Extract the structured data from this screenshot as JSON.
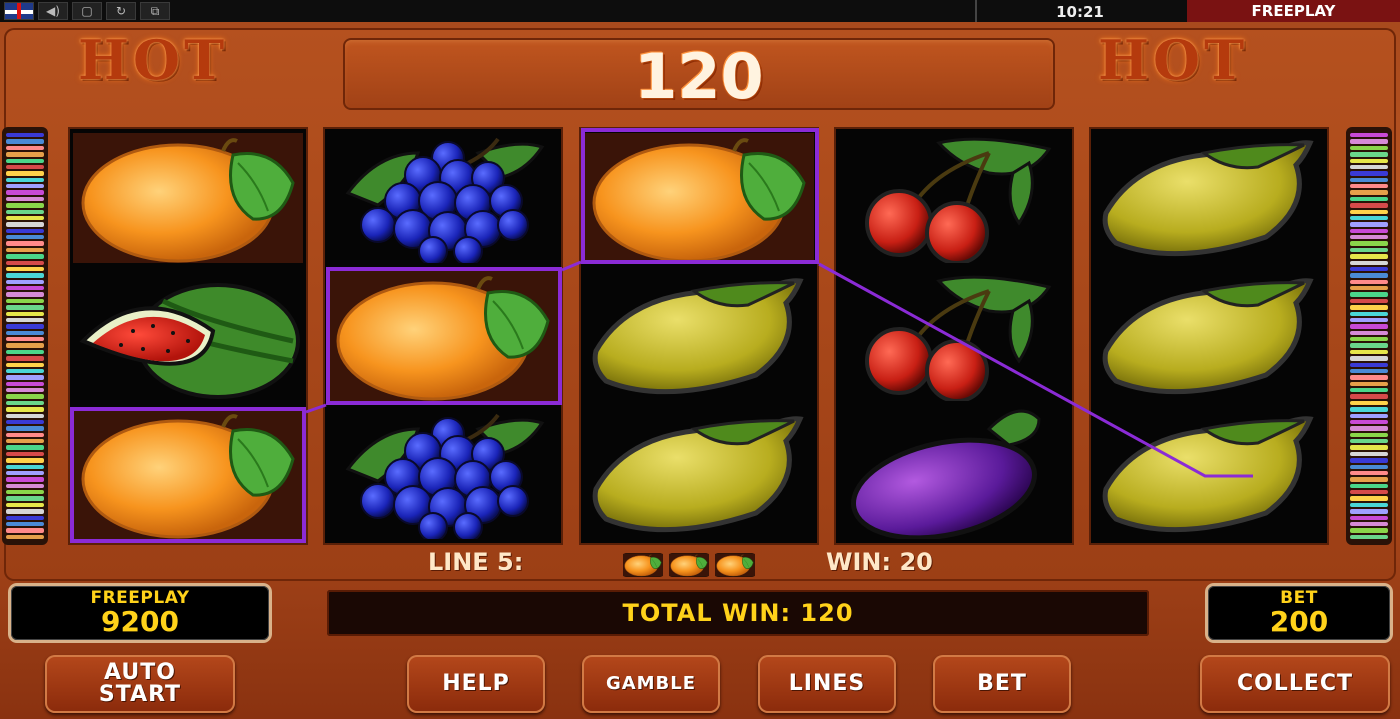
{
  "topbar": {
    "icons": [
      "flag-uk-icon",
      "sound-icon",
      "fullscreen-icon",
      "refresh-icon",
      "window-icon"
    ],
    "clock": "10:21",
    "mode": "FREEPLAY"
  },
  "header": {
    "logo_left": "HOT",
    "logo_right": "HOT",
    "win_display": "120"
  },
  "reels": [
    [
      "orange",
      "watermelon",
      "orange"
    ],
    [
      "grapes",
      "orange",
      "grapes"
    ],
    [
      "orange",
      "lemon",
      "lemon"
    ],
    [
      "cherries",
      "cherries",
      "plum"
    ],
    [
      "lemon",
      "lemon",
      "lemon"
    ]
  ],
  "winning_symbols": [
    {
      "reel": 1,
      "row": 3
    },
    {
      "reel": 2,
      "row": 2
    },
    {
      "reel": 3,
      "row": 1
    }
  ],
  "line_info": {
    "line_label": "LINE 5:",
    "symbols": [
      "orange",
      "orange",
      "orange"
    ],
    "win_label": "WIN: 20"
  },
  "meters": {
    "credit_label": "FREEPLAY",
    "credit_value": "9200",
    "total_win": "TOTAL WIN: 120",
    "bet_label": "BET",
    "bet_value": "200"
  },
  "buttons": {
    "auto_start_line1": "AUTO",
    "auto_start_line2": "START",
    "help": "HELP",
    "gamble": "GAMBLE",
    "lines": "LINES",
    "bet": "BET",
    "collect": "COLLECT"
  },
  "colors": {
    "highlight": "#8b2bd6",
    "meter_text": "#ffd21a",
    "frame": "#b5511f"
  }
}
